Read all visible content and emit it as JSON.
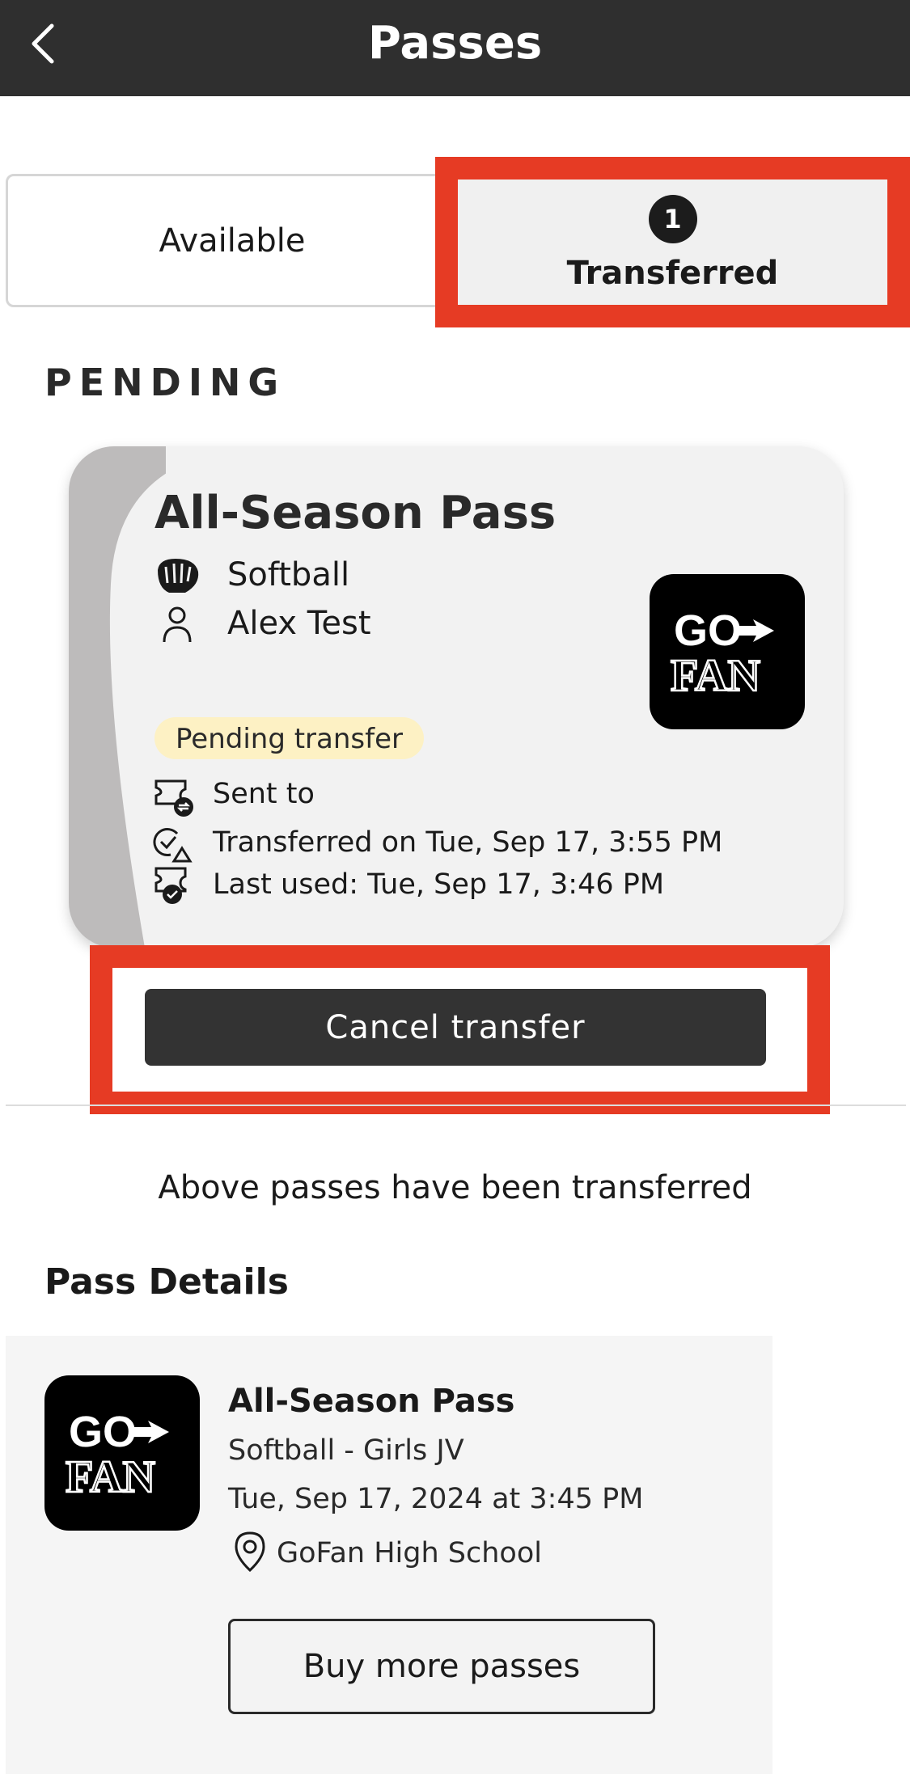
{
  "header": {
    "title": "Passes",
    "back_icon": "chevron-left-icon"
  },
  "tabs": {
    "available_label": "Available",
    "transferred_label": "Transferred",
    "transferred_count": "1"
  },
  "section": {
    "pending_label": "PENDING"
  },
  "pass_card": {
    "title": "All-Season Pass",
    "sport": "Softball",
    "holder": "Alex Test",
    "status_badge": "Pending transfer",
    "sent_to": "Sent to",
    "transferred_on": "Transferred on Tue, Sep 17, 3:55 PM",
    "last_used": "Last used: Tue, Sep 17, 3:46 PM",
    "logo_text_top": "GO",
    "logo_text_bottom": "FAN"
  },
  "actions": {
    "cancel_transfer_label": "Cancel transfer"
  },
  "note": "Above passes have been transferred",
  "pass_details": {
    "heading": "Pass Details",
    "title": "All-Season Pass",
    "event": "Softball - Girls JV",
    "date": "Tue, Sep 17, 2024 at 3:45 PM",
    "venue": "GoFan High School",
    "buy_more_label": "Buy more passes"
  },
  "colors": {
    "header_bg": "#2f2f2f",
    "highlight": "#e63b24",
    "badge_bg": "#fdf1c4",
    "button_dark": "#333333"
  }
}
